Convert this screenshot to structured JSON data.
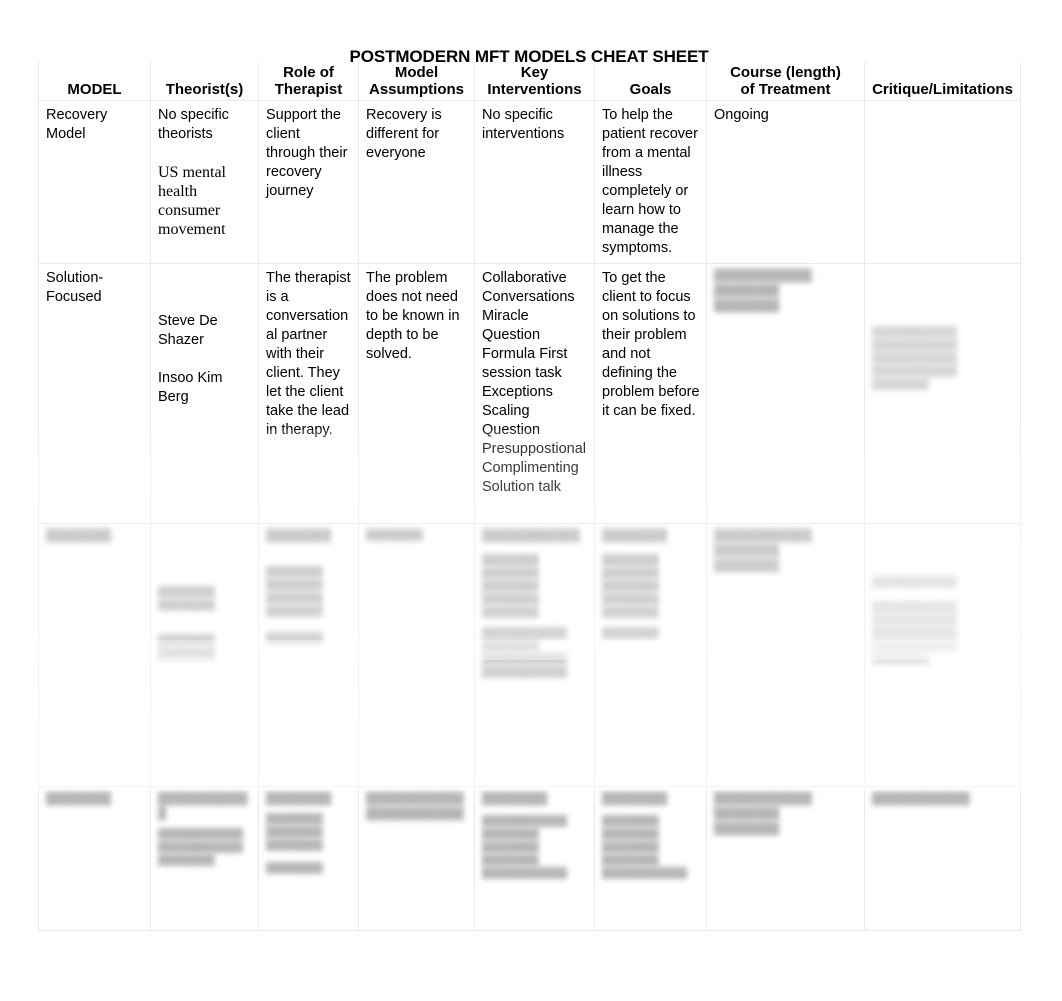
{
  "document": {
    "title": "POSTMODERN MFT MODELS CHEAT SHEET"
  },
  "table": {
    "headers": [
      "MODEL",
      "Theorist(s)",
      "Role of Therapist",
      "Model Assumptions",
      "Key Interventions",
      "Goals",
      "Course (length) of Treatment",
      "Critique/Limitations"
    ],
    "headers_multiline": {
      "role_line1": "Role of",
      "role_line2": "Therapist",
      "assumptions_line1": "Model",
      "assumptions_line2": "Assumptions",
      "interventions_line1": "Key",
      "interventions_line2": "Interventions",
      "course_line1": "Course (length)",
      "course_line2": "of Treatment"
    },
    "rows": [
      {
        "id": "recovery-model",
        "model": "Recovery Model",
        "theorists": [
          "No specific theorists",
          "US mental health consumer movement"
        ],
        "role_of_therapist": "Support the client through their recovery journey",
        "model_assumptions": "Recovery is different for everyone",
        "key_interventions": "No specific interventions",
        "goals": "To help the patient recover from a mental illness completely or learn how to manage the symptoms.",
        "course_of_treatment": "Ongoing",
        "critique_limitations": "",
        "obscured": false
      },
      {
        "id": "solution-focused",
        "model": "Solution-Focused",
        "theorists": [
          "Steve De Shazer",
          "Insoo Kim Berg"
        ],
        "role_of_therapist": "The therapist is a conversational partner with their client. They let the client take the lead in therapy.",
        "model_assumptions": "The problem does not need to be known in depth to be solved.",
        "key_interventions": "Collaborative Conversations Miracle Question Formula First session task Exceptions Scaling Question Presuppostional Complimenting Solution talk",
        "key_interventions_lines": [
          "Collaborative",
          "Conversations",
          "Miracle Question",
          "Formula First",
          "session task",
          "Exceptions",
          "Scaling Question",
          "Presuppostional",
          "Complimenting",
          "Solution talk"
        ],
        "goals": "To get the client to focus on solutions to their problem and not defining the problem before it can be fixed.",
        "course_of_treatment": "",
        "critique_limitations": "",
        "obscured": false
      },
      {
        "id": "row-3",
        "model": "",
        "theorists": [],
        "role_of_therapist": "",
        "model_assumptions": "",
        "key_interventions": "",
        "goals": "",
        "course_of_treatment": "",
        "critique_limitations": "",
        "obscured": true
      },
      {
        "id": "row-4",
        "model": "",
        "theorists": [],
        "role_of_therapist": "",
        "model_assumptions": "",
        "key_interventions": "",
        "goals": "",
        "course_of_treatment": "",
        "critique_limitations": "",
        "obscured": true
      }
    ]
  },
  "obscured_placeholder": {
    "short": "████████",
    "line": "████████████",
    "note": "Content in the lower rows is blurred and unreadable in the source image."
  }
}
